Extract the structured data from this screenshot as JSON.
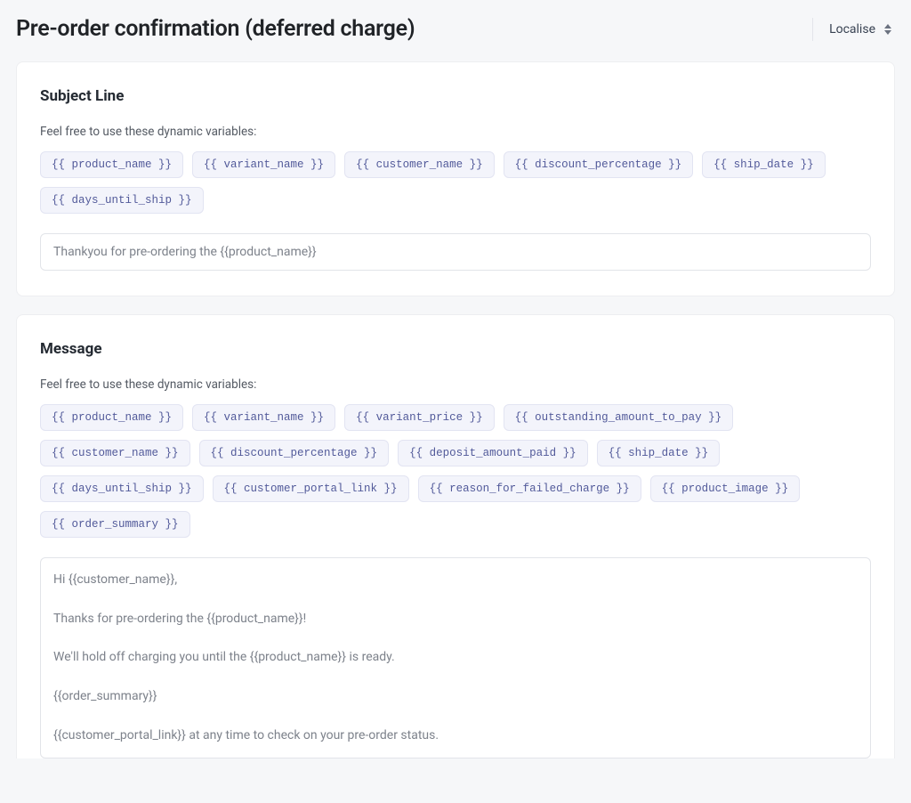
{
  "header": {
    "title": "Pre-order confirmation (deferred charge)",
    "localise_label": "Localise"
  },
  "subject": {
    "heading": "Subject Line",
    "hint": "Feel free to use these dynamic variables:",
    "variables": [
      "{{ product_name }}",
      "{{ variant_name }}",
      "{{ customer_name }}",
      "{{ discount_percentage }}",
      "{{ ship_date }}",
      "{{ days_until_ship }}"
    ],
    "value": "Thankyou for pre-ordering the {{product_name}}"
  },
  "message": {
    "heading": "Message",
    "hint": "Feel free to use these dynamic variables:",
    "variables": [
      "{{ product_name }}",
      "{{ variant_name }}",
      "{{ variant_price }}",
      "{{ outstanding_amount_to_pay }}",
      "{{ customer_name }}",
      "{{ discount_percentage }}",
      "{{ deposit_amount_paid }}",
      "{{ ship_date }}",
      "{{ days_until_ship }}",
      "{{ customer_portal_link }}",
      "{{ reason_for_failed_charge }}",
      "{{ product_image }}",
      "{{ order_summary }}"
    ],
    "body_lines": [
      "Hi {{customer_name}},",
      "Thanks for pre-ordering the {{product_name}}!",
      "We'll hold off charging you until the {{product_name}} is ready.",
      "{{order_summary}}",
      "{{customer_portal_link}} at any time to check on your pre-order status."
    ]
  }
}
